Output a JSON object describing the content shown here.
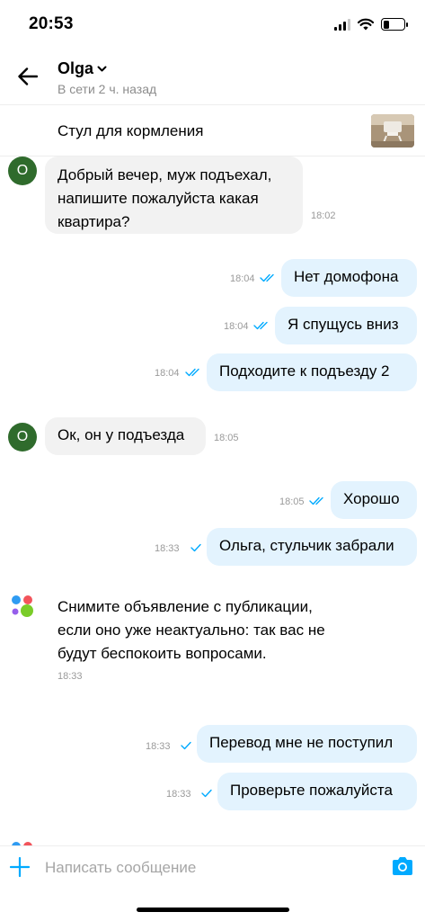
{
  "status_bar": {
    "time": "20:53",
    "icons": [
      "signal-icon",
      "wifi-icon",
      "battery-icon"
    ],
    "battery_level": 0.3
  },
  "header": {
    "contact_name": "Olga",
    "contact_status": "В сети 2 ч. назад",
    "icons": [
      "back-arrow-icon",
      "chevron-down-icon"
    ]
  },
  "listing": {
    "title": "Стул для кормления",
    "thumbnail": "highchair-photo"
  },
  "messages": [
    {
      "dir": "in",
      "avatar_letter": "O",
      "text": "Добрый вечер, муж подъехал, напишите пожалуйста какая квартира?",
      "time": "18:02"
    },
    {
      "dir": "out",
      "text": "Нет домофона",
      "time": "18:04",
      "status": "read"
    },
    {
      "dir": "out",
      "text": "Я спущусь вниз",
      "time": "18:04",
      "status": "read"
    },
    {
      "dir": "out",
      "text": "Подходите к подъезду 2",
      "time": "18:04",
      "status": "read"
    },
    {
      "dir": "in",
      "avatar_letter": "O",
      "text": "Ок, он у подъезда",
      "time": "18:05"
    },
    {
      "dir": "out",
      "text": "Хорошо",
      "time": "18:05",
      "status": "read"
    },
    {
      "dir": "out",
      "text": "Ольга, стульчик забрали",
      "time": "18:33",
      "status": "sent"
    },
    {
      "dir": "system",
      "text": "Снимите объявление с публикации, если оно уже неактуально: так вас не будут беспокоить вопросами.",
      "time": "18:33"
    },
    {
      "dir": "out",
      "text": "Перевод мне не поступил",
      "time": "18:33",
      "status": "sent"
    },
    {
      "dir": "out",
      "text": "Проверьте пожалуйста",
      "time": "18:33",
      "status": "sent"
    }
  ],
  "input": {
    "placeholder": "Написать сообщение",
    "value": "",
    "icons": [
      "plus-icon",
      "camera-icon"
    ]
  },
  "colors": {
    "accent_blue": "#00aaff",
    "outgoing_bubble": "#e3f3fe",
    "incoming_bubble": "#f2f2f2",
    "avatar_green": "#2f6b2c"
  }
}
